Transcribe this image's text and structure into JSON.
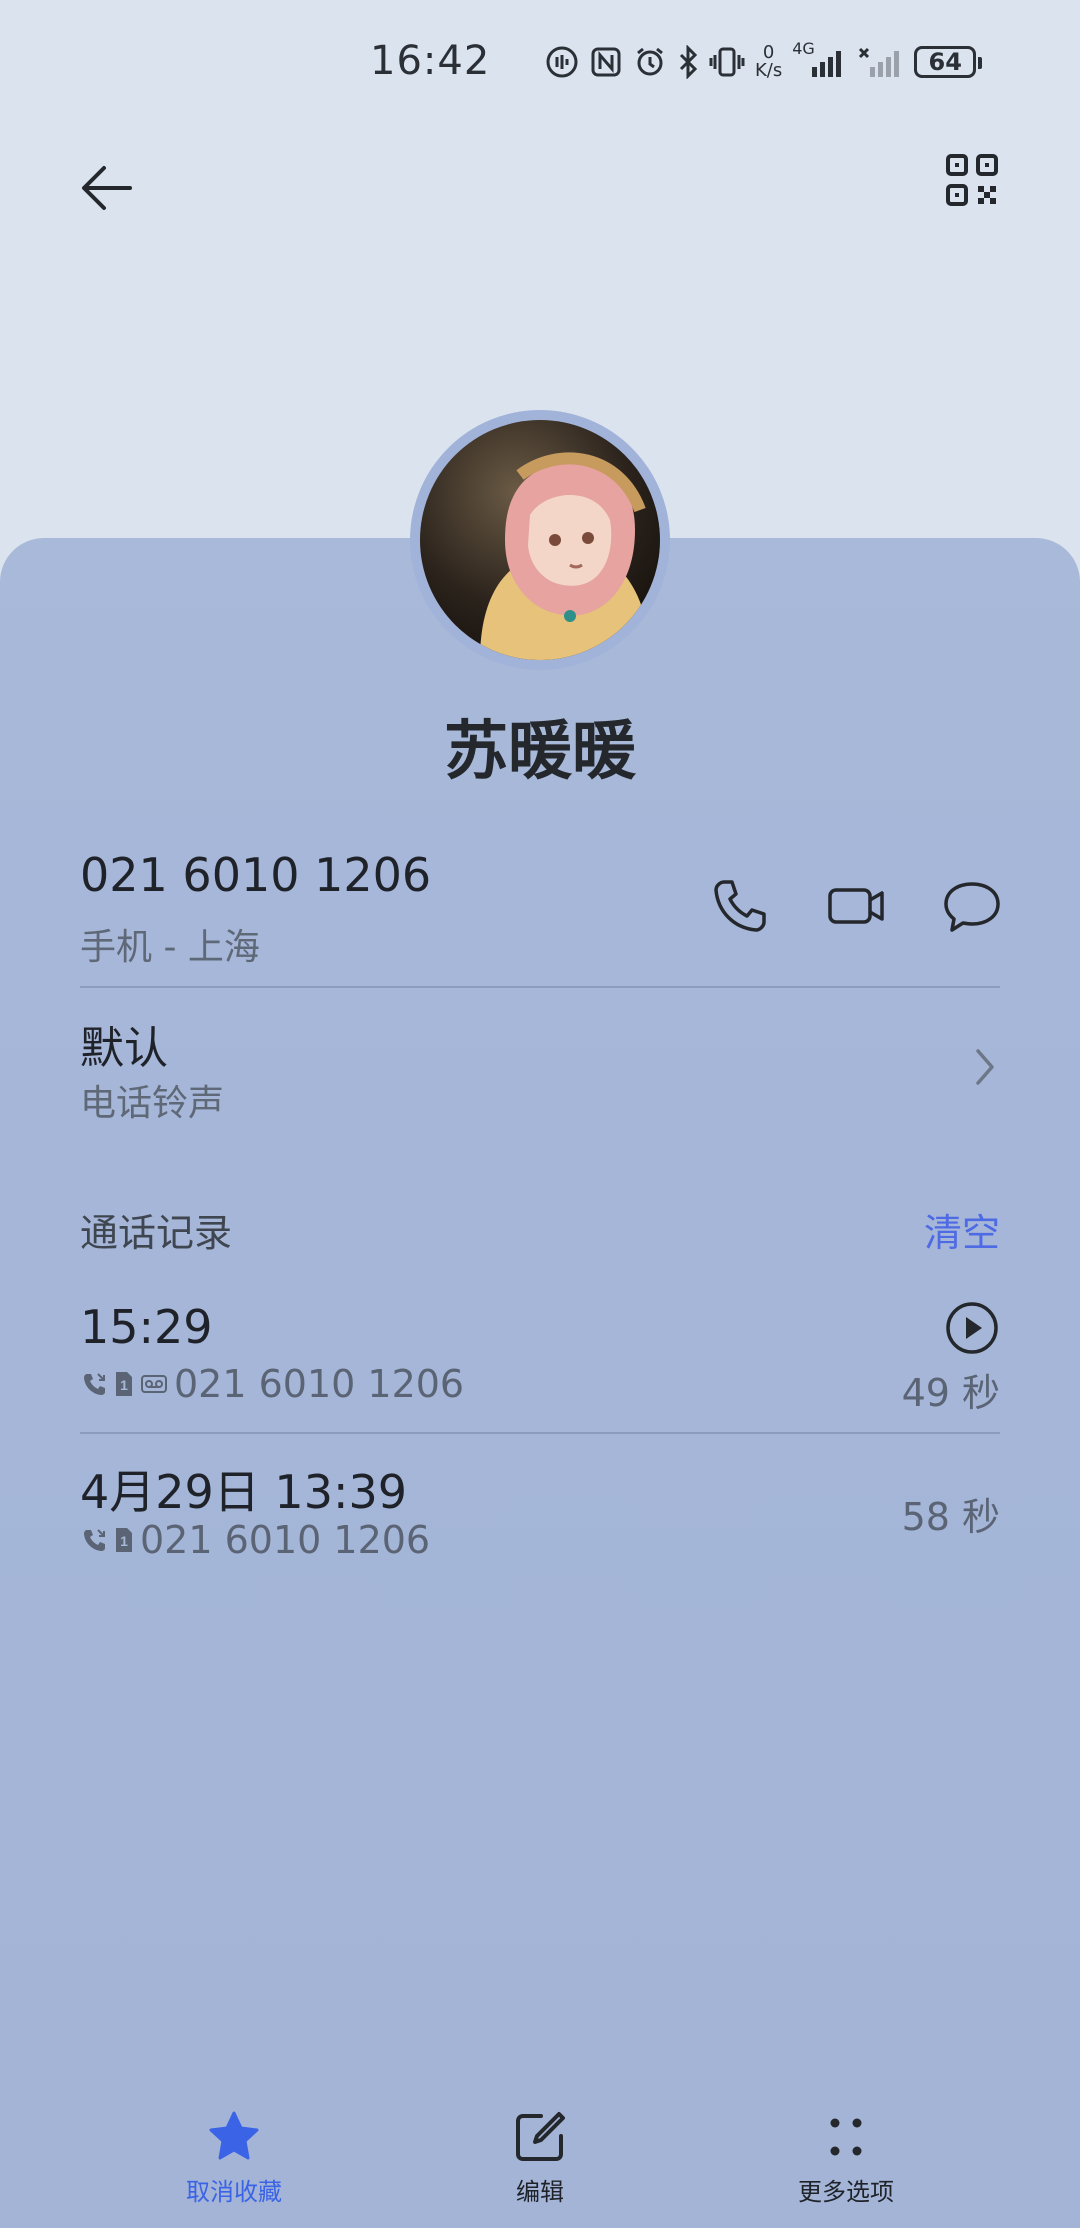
{
  "status_bar": {
    "time": "16:42",
    "net_speed_value": "0",
    "net_speed_unit": "K/s",
    "network_type": "4G",
    "battery": "64"
  },
  "contact": {
    "name": "苏暖暖"
  },
  "phone": {
    "number": "021 6010 1206",
    "label": "手机 - 上海"
  },
  "ringtone": {
    "value": "默认",
    "label": "电话铃声"
  },
  "call_log": {
    "title": "通话记录",
    "clear_label": "清空",
    "items": [
      {
        "time": "15:29",
        "number": "021 6010 1206",
        "duration": "49 秒"
      },
      {
        "time": "4月29日 13:39",
        "number": "021 6010 1206",
        "duration": "58 秒"
      }
    ]
  },
  "bottom_bar": {
    "favorite_label": "取消收藏",
    "edit_label": "编辑",
    "more_label": "更多选项"
  },
  "colors": {
    "accent": "#3b63e6",
    "clear_link": "#4e6be4",
    "sheet": "#a6b7d9",
    "top_background": "#dbe3ee"
  },
  "icons": {
    "back": "arrow-left",
    "qr": "qr-code",
    "call": "phone",
    "video": "video-camera",
    "message": "chat-bubble",
    "chevron": "chevron-right",
    "play": "play-circle",
    "favorite": "star-filled",
    "edit": "edit-square",
    "more": "four-dots"
  }
}
